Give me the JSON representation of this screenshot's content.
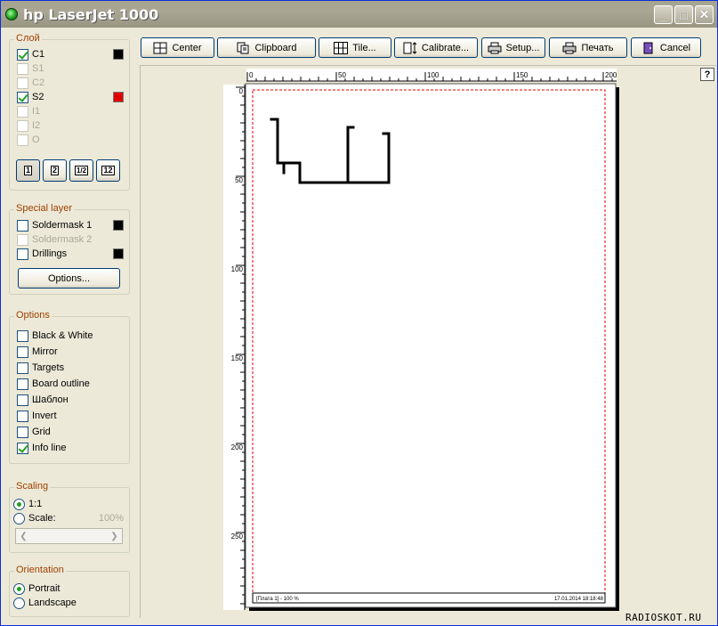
{
  "window": {
    "title": "hp LaserJet 1000",
    "minimize_glyph": "_",
    "maximize_glyph": "□",
    "close_glyph": "✕"
  },
  "layer_group": {
    "title": "Слой",
    "items": [
      {
        "label": "C1",
        "checked": true,
        "disabled": false,
        "color": "#000000"
      },
      {
        "label": "S1",
        "checked": false,
        "disabled": true,
        "color": ""
      },
      {
        "label": "C2",
        "checked": false,
        "disabled": true,
        "color": ""
      },
      {
        "label": "S2",
        "checked": true,
        "disabled": false,
        "color": "#e00000"
      },
      {
        "label": "I1",
        "checked": false,
        "disabled": true,
        "color": ""
      },
      {
        "label": "I2",
        "checked": false,
        "disabled": true,
        "color": ""
      },
      {
        "label": "O",
        "checked": false,
        "disabled": true,
        "color": ""
      }
    ],
    "mode_buttons": [
      "1",
      "2",
      "1/2",
      "12"
    ]
  },
  "special_layer": {
    "title": "Special layer",
    "items": [
      {
        "label": "Soldermask 1",
        "checked": false,
        "disabled": false,
        "color": "#000000"
      },
      {
        "label": "Soldermask 2",
        "checked": false,
        "disabled": true,
        "color": ""
      },
      {
        "label": "Drillings",
        "checked": false,
        "disabled": false,
        "color": "#000000"
      }
    ],
    "options_button": "Options..."
  },
  "options": {
    "title": "Options",
    "items": [
      {
        "label": "Black & White",
        "checked": false
      },
      {
        "label": "Mirror",
        "checked": false
      },
      {
        "label": "Targets",
        "checked": false
      },
      {
        "label": "Board outline",
        "checked": false
      },
      {
        "label": "Шаблон",
        "checked": false
      },
      {
        "label": "Invert",
        "checked": false
      },
      {
        "label": "Grid",
        "checked": false
      },
      {
        "label": "Info line",
        "checked": true
      }
    ]
  },
  "scaling": {
    "title": "Scaling",
    "one_to_one": "1:1",
    "scale_label": "Scale:",
    "scale_value": "100%",
    "selected": "1:1"
  },
  "orientation": {
    "title": "Orientation",
    "portrait": "Portrait",
    "landscape": "Landscape",
    "selected": "Portrait"
  },
  "toolbar": {
    "center": "Center",
    "clipboard": "Clipboard",
    "tile": "Tile...",
    "calibrate": "Calibrate...",
    "setup": "Setup...",
    "print": "Печать",
    "cancel": "Cancel"
  },
  "help_label": "?",
  "ruler": {
    "x_labels": [
      "0",
      "50",
      "100",
      "150",
      "200"
    ],
    "y_labels": [
      "0",
      "50",
      "100",
      "150",
      "200",
      "250"
    ]
  },
  "page": {
    "info_left": "[Плата 1] - 100 %",
    "info_right": "17.01.2014 18:18:48"
  },
  "watermark": "RADIOSKOT.RU"
}
